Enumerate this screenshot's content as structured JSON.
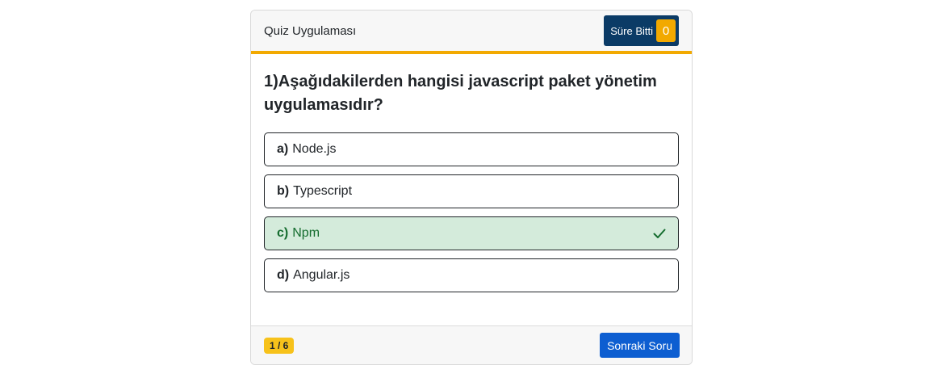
{
  "header": {
    "title": "Quiz Uygulaması",
    "timer_label": "Süre Bitti",
    "timer_value": "0"
  },
  "question": {
    "text": "1)Aşağıdakilerden hangisi javascript paket yönetim uygulamasıdır?"
  },
  "options": [
    {
      "letter": "a)",
      "text": "Node.js",
      "state": "normal"
    },
    {
      "letter": "b)",
      "text": "Typescript",
      "state": "normal"
    },
    {
      "letter": "c)",
      "text": "Npm",
      "state": "correct",
      "icon": "check-icon"
    },
    {
      "letter": "d)",
      "text": "Angular.js",
      "state": "normal"
    }
  ],
  "footer": {
    "progress": "1 / 6",
    "next_label": "Sonraki Soru"
  },
  "colors": {
    "accent": "#f2a900",
    "timer_bg": "#0b3b66",
    "correct_bg": "#d4ebdb",
    "correct_text": "#146c2e",
    "button_bg": "#0d5ed1"
  }
}
